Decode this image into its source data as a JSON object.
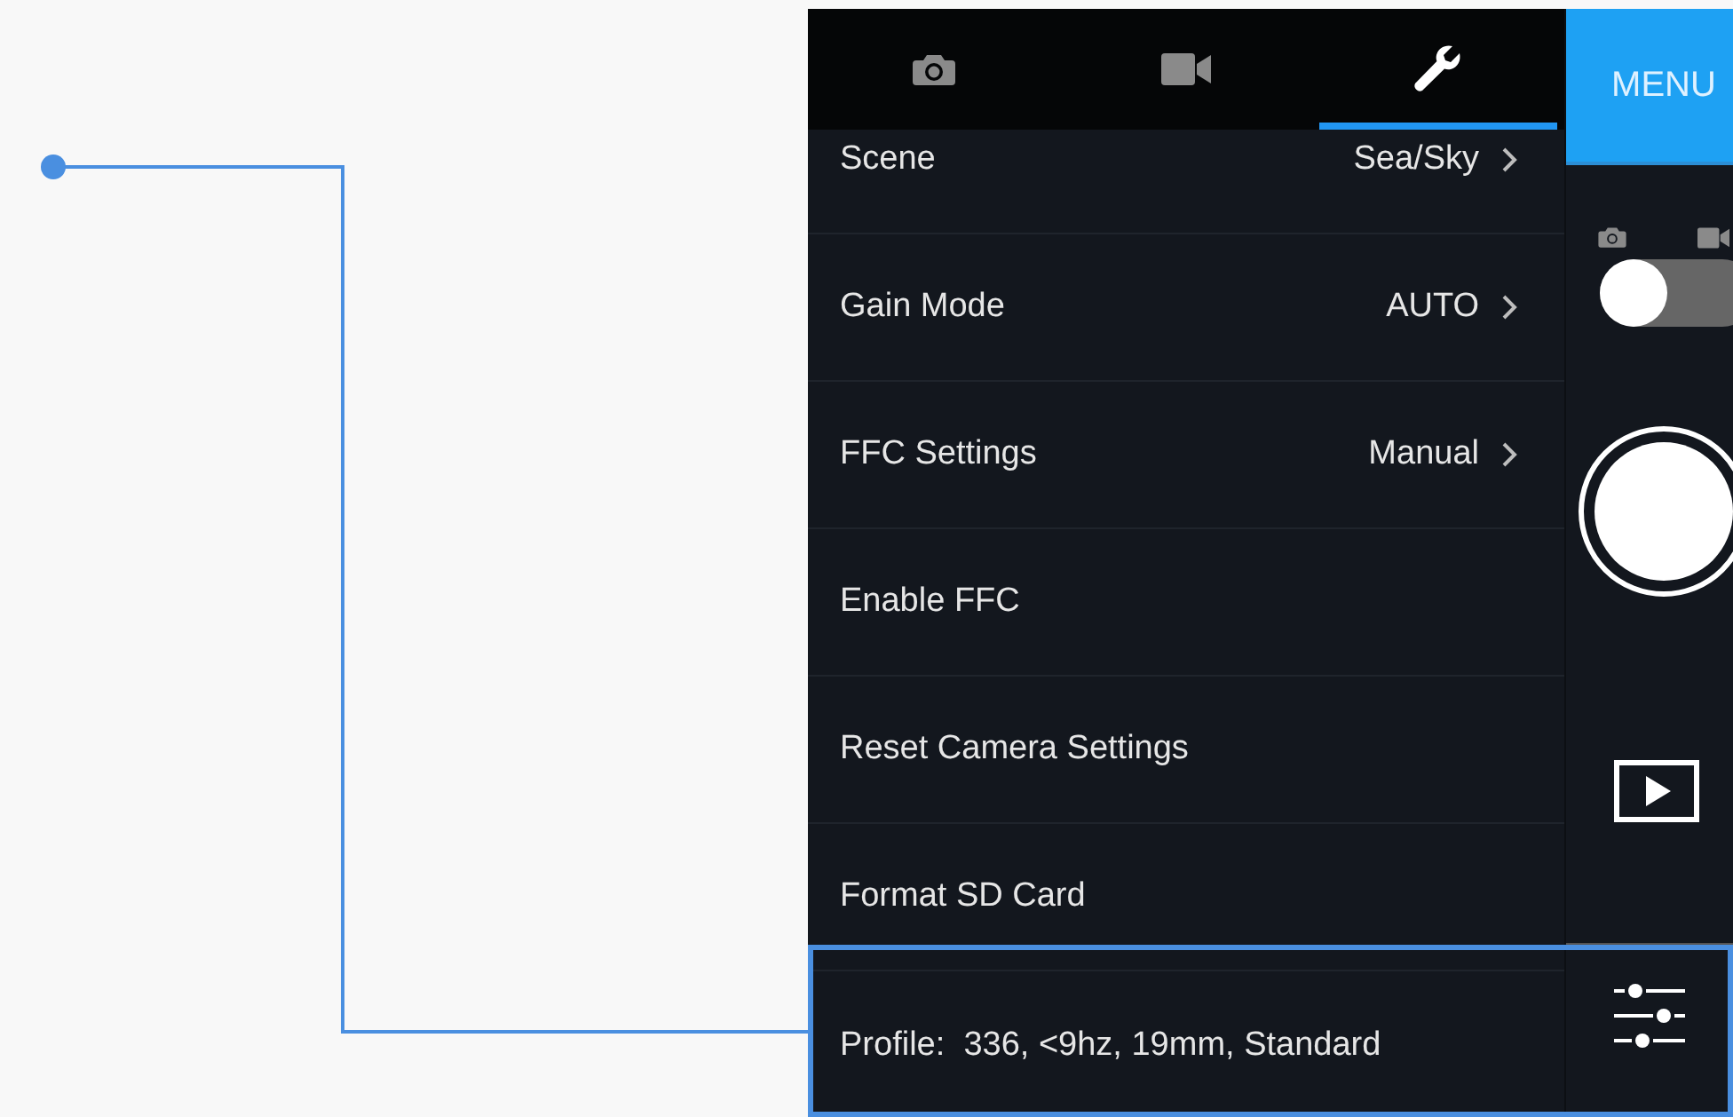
{
  "tabs": [
    {
      "kind": "camera",
      "selected": false
    },
    {
      "kind": "video",
      "selected": false
    },
    {
      "kind": "wrench",
      "selected": true
    }
  ],
  "settings": [
    {
      "label": "Scene",
      "value": "Sea/Sky",
      "kind": "link"
    },
    {
      "label": "Gain Mode",
      "value": "AUTO",
      "kind": "link"
    },
    {
      "label": "FFC Settings",
      "value": "Manual",
      "kind": "link"
    },
    {
      "label": "Enable FFC",
      "kind": "action"
    },
    {
      "label": "Reset Camera Settings",
      "kind": "action"
    },
    {
      "label": "Format SD Card",
      "kind": "action"
    }
  ],
  "profile": {
    "text": "Profile:  336, <9hz, 19mm, Standard",
    "highlighted": true
  },
  "menu_button": "MENU",
  "mode_switch": {
    "on": false
  }
}
